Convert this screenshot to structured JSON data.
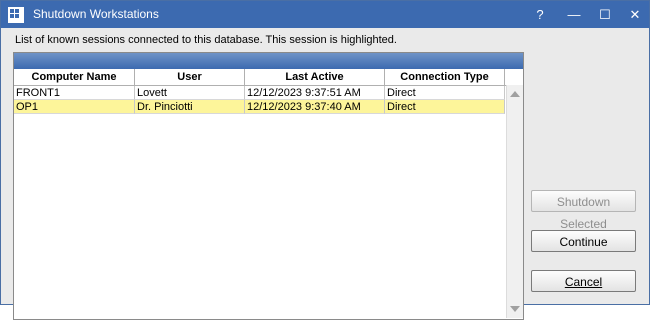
{
  "window": {
    "title": "Shutdown Workstations",
    "help_label": "?",
    "minimize_label": "—",
    "maximize_label": "☐",
    "close_label": "✕"
  },
  "description": "List of known sessions connected to this database. This session is highlighted.",
  "grid": {
    "columns": [
      "Computer Name",
      "User",
      "Last Active",
      "Connection Type"
    ],
    "rows": [
      {
        "computer": "FRONT1",
        "user": "Lovett",
        "last_active": "12/12/2023 9:37:51 AM",
        "connection": "Direct",
        "highlighted": false
      },
      {
        "computer": "OP1",
        "user": "Dr. Pinciotti",
        "last_active": "12/12/2023 9:37:40 AM",
        "connection": "Direct",
        "highlighted": true
      }
    ],
    "highlight_color": "#fdf59a",
    "header_bar_color": "#3c6ab0"
  },
  "buttons": {
    "shutdown_selected": "Shutdown Selected",
    "continue": "Continue",
    "cancel": "Cancel"
  },
  "icons": {
    "app": "grid-app-icon",
    "scroll_up": "scroll-up-arrow-icon",
    "scroll_down": "scroll-down-arrow-icon"
  }
}
